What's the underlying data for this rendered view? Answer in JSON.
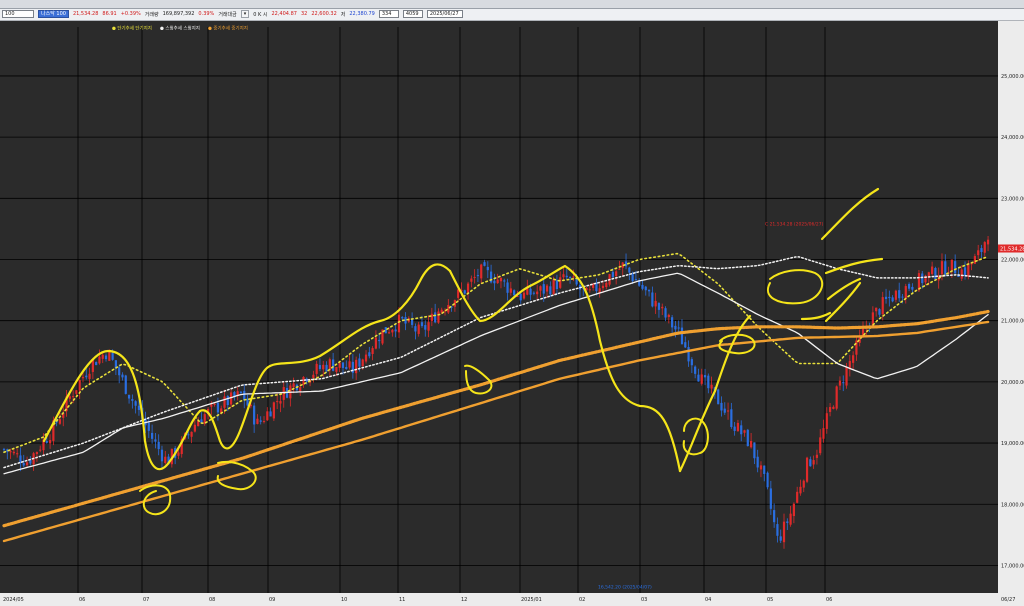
{
  "toolbar": {
    "symbol_code": "100",
    "symbol_name": "나스닥 100",
    "price": "21,534.28",
    "change": "86.91",
    "change_pct": "+0.39%",
    "volume_label": "거래량",
    "volume": "169,897,392",
    "volume_change": "0.39%",
    "amount_label": "거래대금",
    "open_label": "0 K 시",
    "open": "22,404.87",
    "open_change": "32",
    "high": "22,600.32",
    "high_label": "저",
    "low": "22,380.79",
    "count": "334",
    "count_total": "4059",
    "date": "2025/06/27"
  },
  "legend": {
    "items": [
      {
        "label": "단기추세 단기지지",
        "color": "#e8e03a"
      },
      {
        "label": "스윙추세 스윙지지",
        "color": "#f2f2f2"
      },
      {
        "label": "중기추세 중기지지",
        "color": "#f0a030"
      }
    ]
  },
  "annotations": {
    "last_price": "21,534.28",
    "marker_top": "C 21,534.28 (2025/06/27)",
    "marker_bottom": "16,542.20 (2025/04/07)"
  },
  "colors": {
    "background": "#2b2b2b",
    "up": "#e02a2a",
    "down": "#2a6ee0",
    "short_trend": "#e8e03a",
    "swing": "#f2f2f2",
    "mid_trend": "#f0a030",
    "drawing": "#f5e51a",
    "grid": "#000000"
  },
  "chart_data": {
    "type": "candlestick",
    "y_ticks": [
      "17,000.00",
      "18,000.00",
      "19,000.00",
      "20,000.00",
      "21,000.00",
      "22,000.00",
      "23,000.00",
      "24,000.00",
      "25,000.00"
    ],
    "x_labels": [
      "2024/05",
      "06",
      "07",
      "08",
      "09",
      "10",
      "11",
      "12",
      "2025/01",
      "02",
      "03",
      "04",
      "05",
      "06",
      "06/27"
    ],
    "y_range": [
      16550,
      25800
    ],
    "grid": true,
    "close_path": [
      [
        0,
        18900
      ],
      [
        0.6,
        18700
      ],
      [
        1.2,
        19200
      ],
      [
        1.7,
        19800
      ],
      [
        2.2,
        20300
      ],
      [
        2.6,
        20500
      ],
      [
        3.0,
        20000
      ],
      [
        3.4,
        19500
      ],
      [
        3.8,
        19000
      ],
      [
        4.1,
        18700
      ],
      [
        4.4,
        18900
      ],
      [
        4.9,
        19400
      ],
      [
        5.4,
        19600
      ],
      [
        6.0,
        19800
      ],
      [
        6.4,
        19300
      ],
      [
        7.0,
        19800
      ],
      [
        7.6,
        20100
      ],
      [
        8.2,
        20300
      ],
      [
        8.8,
        20200
      ],
      [
        9.5,
        20800
      ],
      [
        10.0,
        21000
      ],
      [
        10.5,
        20800
      ],
      [
        11.0,
        21200
      ],
      [
        11.6,
        21500
      ],
      [
        12.0,
        21800
      ],
      [
        12.4,
        21700
      ],
      [
        13.0,
        21400
      ],
      [
        13.6,
        21500
      ],
      [
        14.2,
        21700
      ],
      [
        14.7,
        21400
      ],
      [
        15.2,
        21700
      ],
      [
        15.6,
        21900
      ],
      [
        16.0,
        21600
      ],
      [
        16.5,
        21200
      ],
      [
        17.0,
        20800
      ],
      [
        17.3,
        20400
      ],
      [
        17.6,
        20000
      ],
      [
        18.0,
        19700
      ],
      [
        18.4,
        19300
      ],
      [
        18.8,
        19000
      ],
      [
        19.2,
        18300
      ],
      [
        19.5,
        17400
      ],
      [
        19.8,
        17800
      ],
      [
        20.2,
        18600
      ],
      [
        20.5,
        18900
      ],
      [
        20.9,
        19700
      ],
      [
        21.3,
        20300
      ],
      [
        21.8,
        21000
      ],
      [
        22.2,
        21300
      ],
      [
        22.6,
        21500
      ],
      [
        23.2,
        21700
      ],
      [
        23.8,
        21900
      ],
      [
        24.2,
        21800
      ],
      [
        24.6,
        22100
      ],
      [
        24.8,
        22450
      ]
    ],
    "series": [
      {
        "name": "단기추세",
        "style": "dotted",
        "points": [
          [
            0,
            18850
          ],
          [
            1,
            19100
          ],
          [
            2,
            19900
          ],
          [
            3,
            20300
          ],
          [
            4,
            20000
          ],
          [
            5,
            19300
          ],
          [
            6,
            19700
          ],
          [
            7,
            19800
          ],
          [
            8,
            20100
          ],
          [
            9,
            20600
          ],
          [
            10,
            21000
          ],
          [
            11,
            21100
          ],
          [
            12,
            21600
          ],
          [
            13,
            21850
          ],
          [
            14,
            21650
          ],
          [
            15,
            21750
          ],
          [
            16,
            22000
          ],
          [
            17,
            22100
          ],
          [
            18,
            21600
          ],
          [
            19,
            20900
          ],
          [
            20,
            20300
          ],
          [
            21,
            20300
          ],
          [
            22,
            21000
          ],
          [
            23,
            21500
          ],
          [
            24,
            21850
          ],
          [
            24.8,
            22050
          ]
        ]
      },
      {
        "name": "스윙추세",
        "style": "dotted",
        "points": [
          [
            0,
            18600
          ],
          [
            2,
            19000
          ],
          [
            4,
            19500
          ],
          [
            6,
            19950
          ],
          [
            8,
            20050
          ],
          [
            10,
            20400
          ],
          [
            12,
            21050
          ],
          [
            14,
            21450
          ],
          [
            16,
            21800
          ],
          [
            17,
            21900
          ],
          [
            18,
            21850
          ],
          [
            19,
            21900
          ],
          [
            20,
            22050
          ],
          [
            21,
            21850
          ],
          [
            22,
            21700
          ],
          [
            23,
            21700
          ],
          [
            24,
            21750
          ],
          [
            24.8,
            21700
          ]
        ]
      },
      {
        "name": "스윙지지",
        "style": "solid",
        "points": [
          [
            0,
            18500
          ],
          [
            2,
            18850
          ],
          [
            3,
            19250
          ],
          [
            4,
            19400
          ],
          [
            6,
            19800
          ],
          [
            8,
            19850
          ],
          [
            10,
            20150
          ],
          [
            12,
            20750
          ],
          [
            14,
            21250
          ],
          [
            16,
            21650
          ],
          [
            17,
            21780
          ],
          [
            18,
            21450
          ],
          [
            19,
            21100
          ],
          [
            20,
            20800
          ],
          [
            21,
            20300
          ],
          [
            22,
            20050
          ],
          [
            23,
            20250
          ],
          [
            24,
            20700
          ],
          [
            24.8,
            21100
          ]
        ]
      },
      {
        "name": "중기추세",
        "style": "dotted",
        "points": [
          [
            0,
            17650
          ],
          [
            3,
            18200
          ],
          [
            6,
            18750
          ],
          [
            9,
            19400
          ],
          [
            12,
            19950
          ],
          [
            14,
            20350
          ],
          [
            16,
            20650
          ],
          [
            17,
            20800
          ],
          [
            18,
            20870
          ],
          [
            19,
            20900
          ],
          [
            20,
            20900
          ],
          [
            21,
            20880
          ],
          [
            22,
            20900
          ],
          [
            23,
            20950
          ],
          [
            24,
            21050
          ],
          [
            24.8,
            21150
          ]
        ]
      },
      {
        "name": "중기지지",
        "style": "solid",
        "points": [
          [
            0,
            17400
          ],
          [
            3,
            17950
          ],
          [
            6,
            18500
          ],
          [
            9,
            19050
          ],
          [
            12,
            19650
          ],
          [
            14,
            20050
          ],
          [
            16,
            20350
          ],
          [
            18,
            20600
          ],
          [
            20,
            20720
          ],
          [
            22,
            20750
          ],
          [
            23,
            20800
          ],
          [
            24,
            20900
          ],
          [
            24.8,
            20980
          ]
        ]
      }
    ]
  }
}
